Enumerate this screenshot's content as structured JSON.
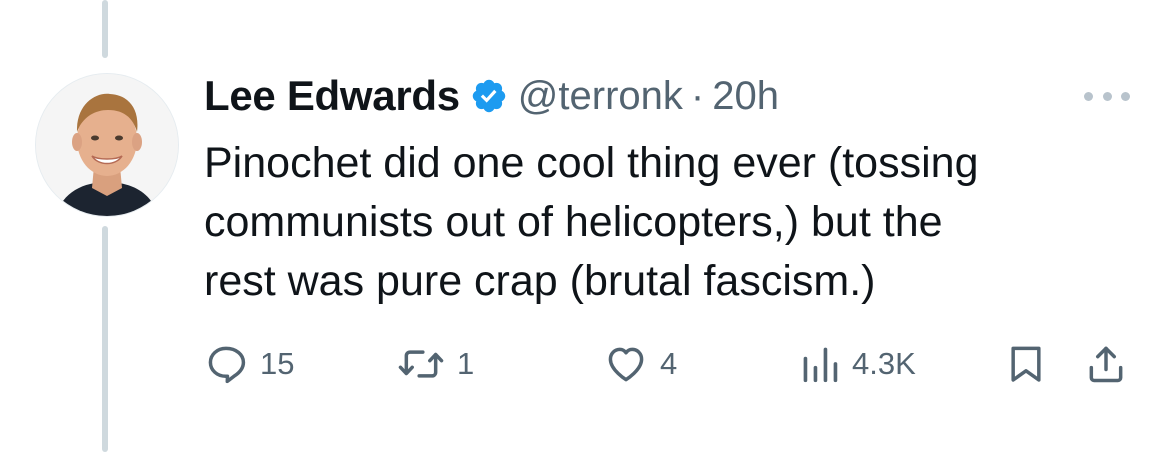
{
  "tweet": {
    "author": {
      "display_name": "Lee Edwards",
      "handle": "@terronk",
      "verified_icon": "verified-badge-icon"
    },
    "separator": "·",
    "timestamp": "20h",
    "text": "Pinochet did one cool thing ever (tossing\ncommunists out of helicopters,) but the\nrest was pure crap (brutal fascism.)",
    "actions": {
      "replies": "15",
      "retweets": "1",
      "likes": "4",
      "views": "4.3K"
    }
  },
  "colors": {
    "text_primary": "#0f1419",
    "text_secondary": "#536471",
    "verified_blue": "#1d9bf0",
    "thread_line": "#cfd9de"
  }
}
